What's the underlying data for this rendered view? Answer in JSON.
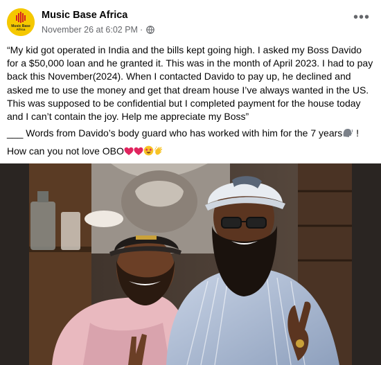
{
  "post": {
    "author": "Music Base Africa",
    "avatar_text_line1": "Music Base",
    "avatar_text_line2": "Africa",
    "timestamp": "November 26 at 6:02 PM",
    "separator": "·",
    "more_label": "•••",
    "quote": "“My kid got operated in India and the bills kept going high. I asked my Boss Davido for a $50,000 loan and he granted it. This was in the month of April 2023. I had to pay back this November(2024). When I contacted Davido to pay up, he declined and asked me to use the money and get that dream house I’ve always wanted in the US. This was supposed to be confidential but I completed payment for the house today and I can’t contain the joy. Help me appreciate my Boss”",
    "words_line": "___ Words from Davido’s body guard who has worked with him for the 7 years",
    "words_suffix": " !",
    "closing_line": "How can you not love OBO"
  },
  "colors": {
    "avatar_bg": "#f5c800",
    "avatar_mark": "#d62020",
    "meta_gray": "#65676b",
    "photo_bg": "#2a2522"
  },
  "icons": [
    "globe-icon",
    "more-options-icon",
    "speaking-head-icon",
    "red-heart-icon",
    "star-struck-icon",
    "clapping-hands-icon"
  ]
}
